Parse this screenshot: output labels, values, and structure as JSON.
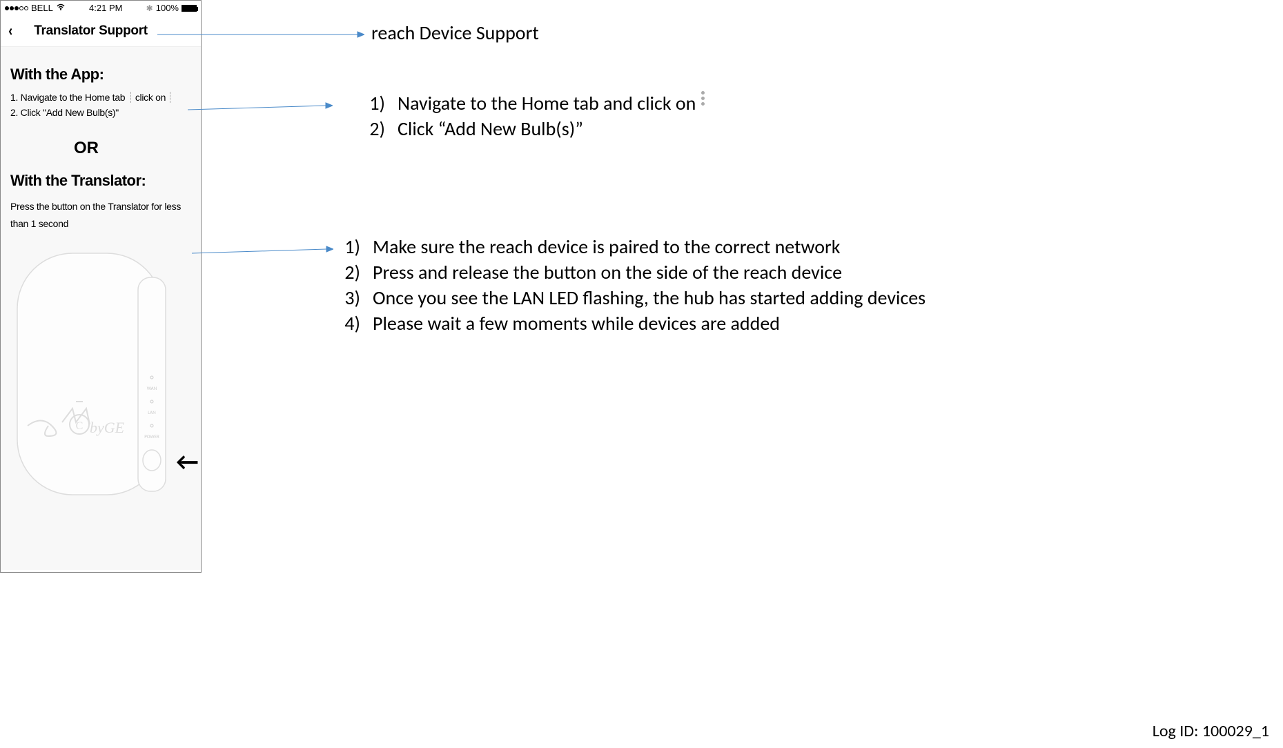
{
  "phone": {
    "status_bar": {
      "carrier": "BELL",
      "time": "4:21 PM",
      "battery_pct": "100%"
    },
    "nav_title": "Translator Support",
    "section1_header": "With the App:",
    "section1_step1_prefix": "1. Navigate to the Home tab",
    "section1_step1_suffix": "click on",
    "section1_step2": "2. Click \"Add New Bulb(s)\"",
    "or_label": "OR",
    "section2_header": "With the Translator:",
    "section2_text": "Press the button on the Translator for less than 1 second",
    "device_labels": {
      "wan": "WAN",
      "lan": "LAN",
      "power": "POWER"
    }
  },
  "annotations": {
    "title": "reach Device Support",
    "list1": [
      "Navigate to the Home tab and click on",
      "Click “Add New Bulb(s)”"
    ],
    "list2": [
      "Make sure the reach device is paired to the correct network",
      "Press and release the button on the side of the reach device",
      "Once you see the LAN LED flashing, the hub has started adding devices",
      "Please wait a few moments while devices are added"
    ]
  },
  "log_id": "Log ID: 100029_1"
}
